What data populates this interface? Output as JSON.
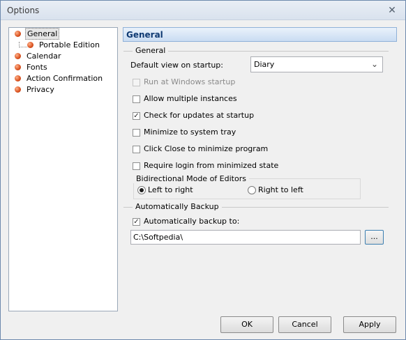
{
  "window": {
    "title": "Options",
    "close_glyph": "✕"
  },
  "tree": {
    "items": [
      {
        "label": "General",
        "selected": true
      },
      {
        "label": "Portable Edition",
        "child": true
      },
      {
        "label": "Calendar"
      },
      {
        "label": "Fonts"
      },
      {
        "label": "Action Confirmation"
      },
      {
        "label": "Privacy"
      }
    ]
  },
  "panel": {
    "header": "General"
  },
  "general": {
    "group_title": "General",
    "default_view_label": "Default view on startup:",
    "default_view_value": "Diary",
    "options": [
      {
        "label": "Run at Windows startup",
        "checked": false,
        "disabled": true
      },
      {
        "label": "Allow multiple instances",
        "checked": false
      },
      {
        "label": "Check for updates at startup",
        "checked": true
      },
      {
        "label": "Minimize to system tray",
        "checked": false
      },
      {
        "label": "Click Close to minimize program",
        "checked": false
      },
      {
        "label": "Require login from minimized state",
        "checked": false
      }
    ],
    "bidi": {
      "title": "Bidirectional Mode of Editors",
      "left_to_right": "Left to right",
      "right_to_left": "Right to left",
      "selected": "left_to_right"
    }
  },
  "backup": {
    "group_title": "Automatically Backup",
    "checkbox_label": "Automatically backup to:",
    "checked": true,
    "path": "C:\\Softpedia\\",
    "browse_label": "..."
  },
  "buttons": {
    "ok": "OK",
    "cancel": "Cancel",
    "apply": "Apply"
  }
}
